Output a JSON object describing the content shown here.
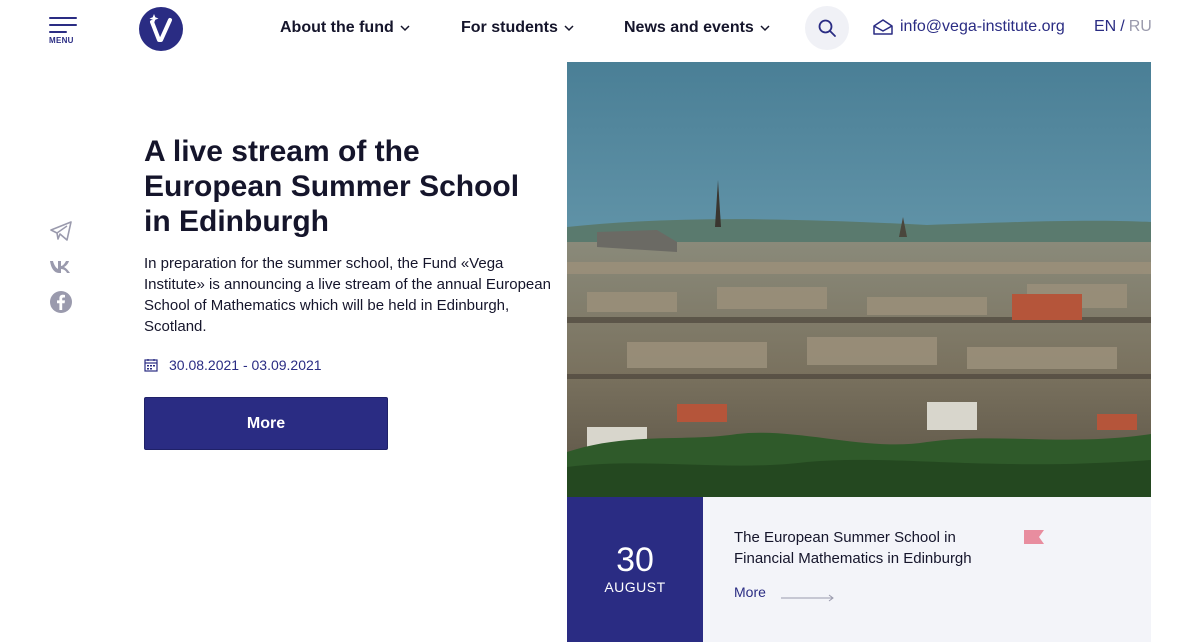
{
  "header": {
    "menu_label": "MENU",
    "nav": [
      {
        "label": "About the fund"
      },
      {
        "label": "For students"
      },
      {
        "label": "News and events"
      }
    ],
    "email": "info@vega-institute.org",
    "lang": {
      "en": "EN",
      "separator": "/",
      "ru": "RU",
      "active": "EN"
    }
  },
  "social": [
    "telegram-icon",
    "vk-icon",
    "facebook-icon"
  ],
  "article": {
    "title": "A live stream of the European Summer School in Edinburgh",
    "description": "In preparation for the summer school, the Fund «Vega Institute» is announcing a live stream of the annual European School of Mathematics which will be held in Edinburgh, Scotland.",
    "dates": "30.08.2021 - 03.09.2021",
    "more_label": "More"
  },
  "event": {
    "day": "30",
    "month": "AUGUST",
    "title": "The European Summer School in Financial Mathematics in Edinburgh",
    "more_label": "More"
  },
  "colors": {
    "primary": "#2a2c83",
    "text": "#15152b",
    "muted": "#9a9aad",
    "card_bg": "#f3f4f9",
    "flag": "#e88d9f"
  }
}
